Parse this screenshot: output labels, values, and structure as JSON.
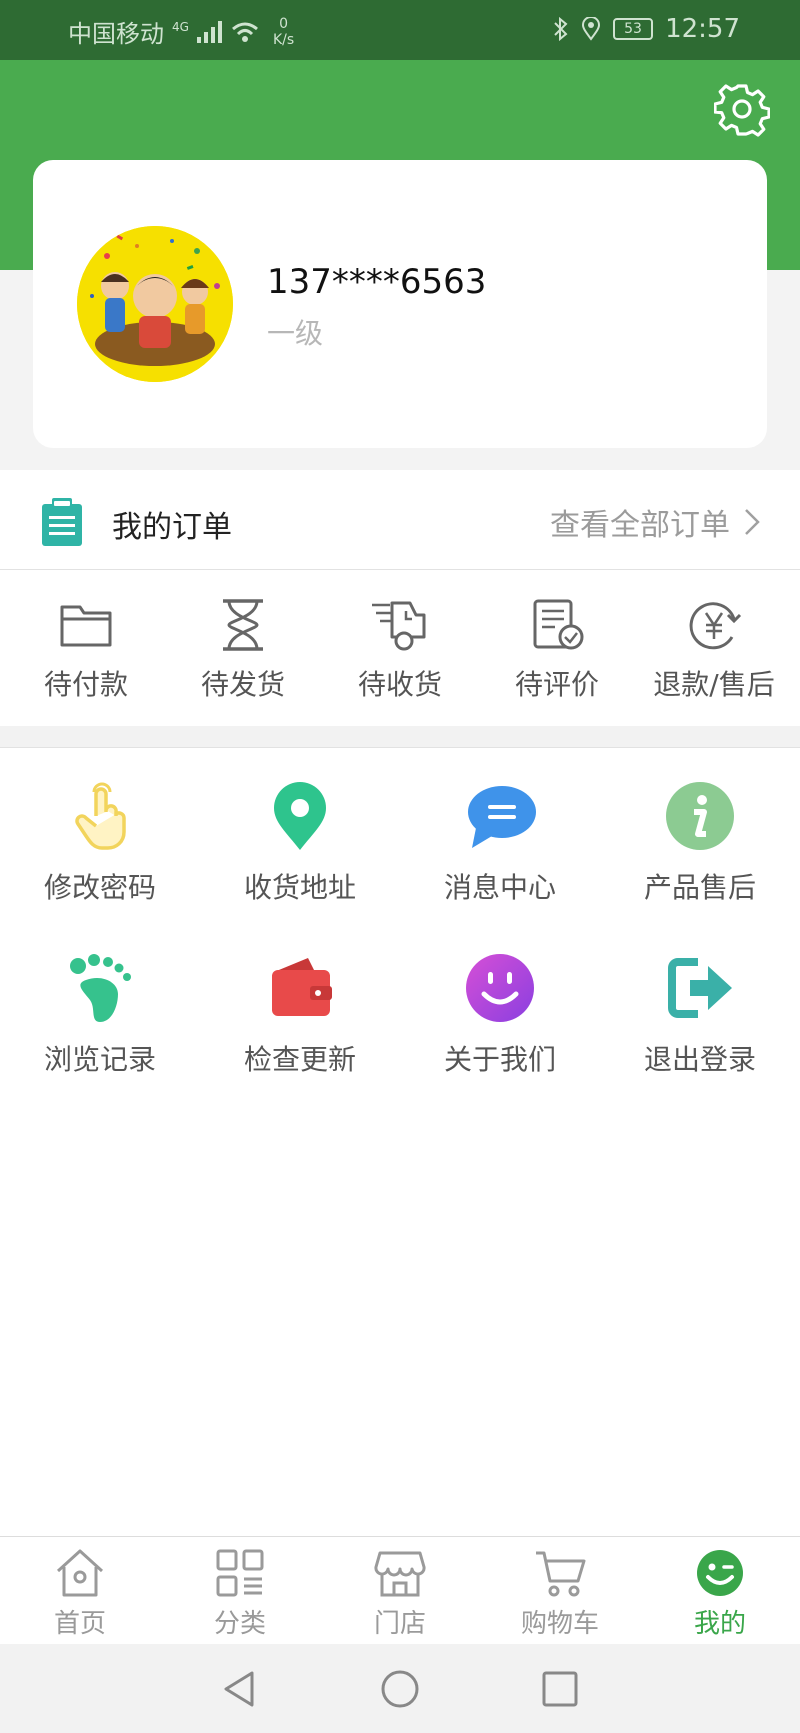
{
  "status_bar": {
    "carrier": "中国移动",
    "network": "4G",
    "speed_value": "0",
    "speed_unit": "K/s",
    "battery": "53",
    "time": "12:57"
  },
  "profile": {
    "phone": "137****6563",
    "level": "一级"
  },
  "orders": {
    "title": "我的订单",
    "view_all": "查看全部订单",
    "statuses": [
      {
        "label": "待付款",
        "icon": "wallet-folder-icon"
      },
      {
        "label": "待发货",
        "icon": "hourglass-icon"
      },
      {
        "label": "待收货",
        "icon": "delivery-truck-icon"
      },
      {
        "label": "待评价",
        "icon": "review-doc-icon"
      },
      {
        "label": "退款/售后",
        "icon": "refund-icon"
      }
    ]
  },
  "services": [
    {
      "label": "修改密码",
      "icon": "hand-pointer-icon",
      "color": "#f2d45c"
    },
    {
      "label": "收货地址",
      "icon": "location-pin-icon",
      "color": "#2ec48d"
    },
    {
      "label": "消息中心",
      "icon": "chat-bubble-icon",
      "color": "#3f93ea"
    },
    {
      "label": "产品售后",
      "icon": "info-icon",
      "color": "#8ccb92"
    },
    {
      "label": "浏览记录",
      "icon": "footprint-icon",
      "color": "#36c28d"
    },
    {
      "label": "检查更新",
      "icon": "wallet-icon",
      "color": "#e84a4a"
    },
    {
      "label": "关于我们",
      "icon": "smiley-icon",
      "color": "#b04fe0"
    },
    {
      "label": "退出登录",
      "icon": "logout-icon",
      "color": "#3ab0a8"
    }
  ],
  "bottom_nav": {
    "active": "我的",
    "items": [
      {
        "label": "首页",
        "icon": "home-icon"
      },
      {
        "label": "分类",
        "icon": "category-icon"
      },
      {
        "label": "门店",
        "icon": "store-icon"
      },
      {
        "label": "购物车",
        "icon": "cart-icon"
      },
      {
        "label": "我的",
        "icon": "profile-smile-icon"
      }
    ]
  },
  "colors": {
    "brand_green": "#4aab4f",
    "status_bar_green": "#2e6b33",
    "active_nav": "#3aa64a"
  }
}
